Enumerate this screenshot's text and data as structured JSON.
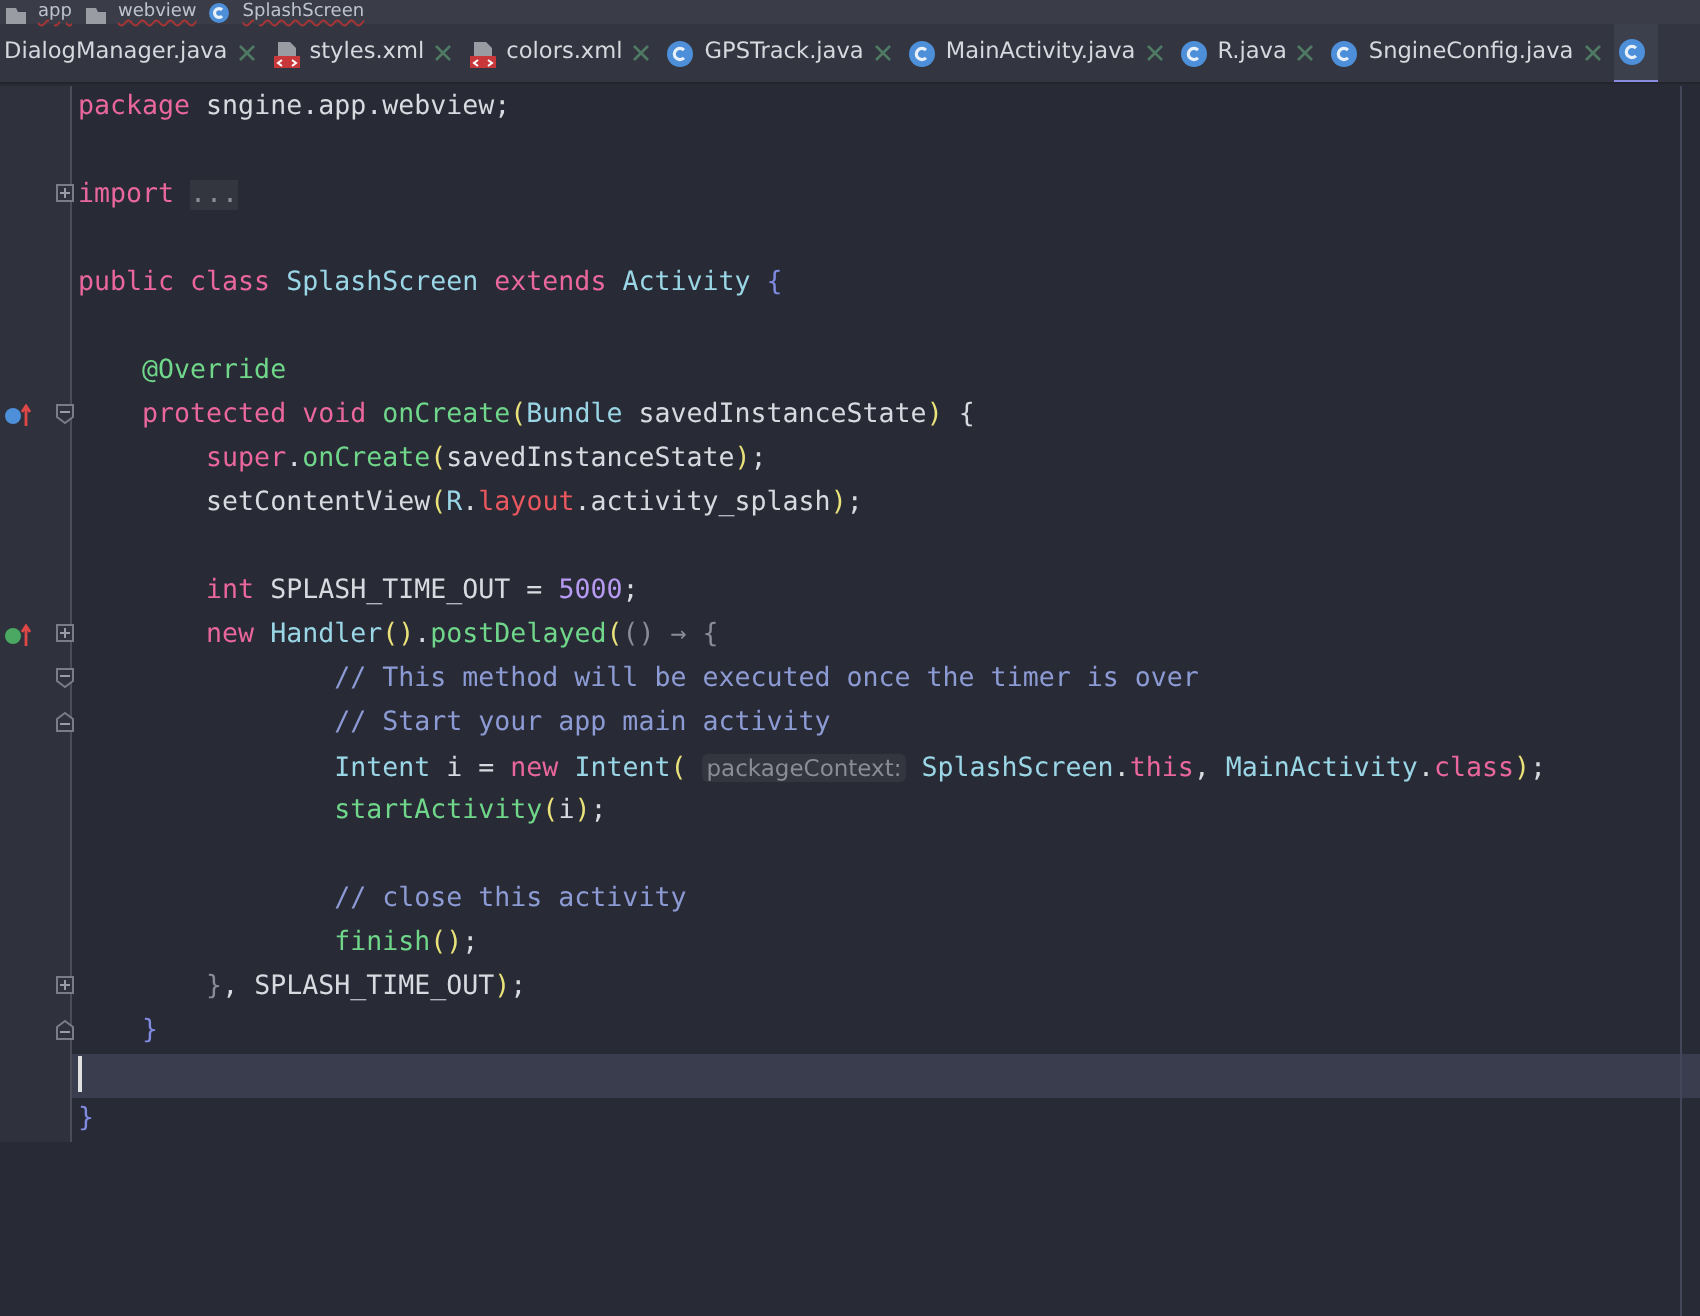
{
  "breadcrumb": [
    {
      "label": "app",
      "kind": "folder"
    },
    {
      "label": "webview",
      "kind": "folder"
    },
    {
      "label": "SplashScreen",
      "kind": "class"
    }
  ],
  "tabs": [
    {
      "label": "DialogManager.java",
      "kind": "plain",
      "selected": false
    },
    {
      "label": "styles.xml",
      "kind": "xml",
      "selected": false
    },
    {
      "label": "colors.xml",
      "kind": "xml",
      "selected": false
    },
    {
      "label": "GPSTrack.java",
      "kind": "class",
      "selected": false
    },
    {
      "label": "MainActivity.java",
      "kind": "class",
      "selected": false
    },
    {
      "label": "R.java",
      "kind": "class",
      "selected": false
    },
    {
      "label": "SngineConfig.java",
      "kind": "class",
      "selected": false
    },
    {
      "kind": "class",
      "selected": true
    }
  ],
  "lines": [
    {
      "current": false,
      "tokens": [
        {
          "text": "package ",
          "kind": "keyword"
        },
        {
          "text": "sngine.app.webview;",
          "kind": "plain"
        }
      ]
    },
    {
      "current": false
    },
    {
      "current": false,
      "gutter": [
        {
          "kind": "fold-collapsed"
        }
      ],
      "tokens": [
        {
          "text": "import ",
          "kind": "keyword"
        },
        {
          "text": "...",
          "kind": "folded"
        }
      ]
    },
    {
      "current": false
    },
    {
      "current": false,
      "tokens": [
        {
          "text": "public class ",
          "kind": "keyword"
        },
        {
          "text": "SplashScreen ",
          "kind": "type"
        },
        {
          "text": "extends ",
          "kind": "keyword"
        },
        {
          "text": "Activity ",
          "kind": "type"
        },
        {
          "text": "{",
          "kind": "brace"
        }
      ]
    },
    {
      "current": false
    },
    {
      "current": false,
      "tokens": [
        {
          "text": "    @Override",
          "kind": "annotation"
        }
      ]
    },
    {
      "current": false,
      "gutter": [
        {
          "kind": "override"
        },
        {
          "kind": "fold-start"
        }
      ],
      "tokens": [
        {
          "text": "    protected void ",
          "kind": "keyword"
        },
        {
          "text": "onCreate",
          "kind": "method"
        },
        {
          "text": "(",
          "kind": "paren"
        },
        {
          "text": "Bundle ",
          "kind": "type"
        },
        {
          "text": "savedInstanceState",
          "kind": "plain"
        },
        {
          "text": ")",
          "kind": "paren"
        },
        {
          "text": " {",
          "kind": "plain"
        }
      ]
    },
    {
      "current": false,
      "tokens": [
        {
          "text": "        super",
          "kind": "keyword"
        },
        {
          "text": ".",
          "kind": "plain"
        },
        {
          "text": "onCreate",
          "kind": "method"
        },
        {
          "text": "(",
          "kind": "paren"
        },
        {
          "text": "savedInstanceState",
          "kind": "plain"
        },
        {
          "text": ")",
          "kind": "paren"
        },
        {
          "text": ";",
          "kind": "plain"
        }
      ]
    },
    {
      "current": false,
      "tokens": [
        {
          "text": "        setContentView",
          "kind": "plain"
        },
        {
          "text": "(",
          "kind": "paren"
        },
        {
          "text": "R",
          "kind": "type"
        },
        {
          "text": ".",
          "kind": "plain"
        },
        {
          "text": "layout",
          "kind": "field"
        },
        {
          "text": ".activity_splash",
          "kind": "plain"
        },
        {
          "text": ")",
          "kind": "paren"
        },
        {
          "text": ";",
          "kind": "plain"
        }
      ]
    },
    {
      "current": false
    },
    {
      "current": false,
      "tokens": [
        {
          "text": "        int ",
          "kind": "keyword"
        },
        {
          "text": "SPLASH_TIME_OUT = ",
          "kind": "plain"
        },
        {
          "text": "5000",
          "kind": "number"
        },
        {
          "text": ";",
          "kind": "plain"
        }
      ]
    },
    {
      "current": false,
      "gutter": [
        {
          "kind": "implements"
        },
        {
          "kind": "fold-collapsed"
        }
      ],
      "tokens": [
        {
          "text": "        new ",
          "kind": "keyword"
        },
        {
          "text": "Handler",
          "kind": "type"
        },
        {
          "text": "()",
          "kind": "paren"
        },
        {
          "text": ".",
          "kind": "plain"
        },
        {
          "text": "postDelayed",
          "kind": "method"
        },
        {
          "text": "(",
          "kind": "paren"
        },
        {
          "text": "() → {",
          "kind": "lambda"
        }
      ]
    },
    {
      "current": false,
      "gutter": [
        {
          "kind": "fold-start"
        }
      ],
      "tokens": [
        {
          "text": "                // This method will be executed once the timer is over",
          "kind": "comment"
        }
      ]
    },
    {
      "current": false,
      "gutter": [
        {
          "kind": "fold-end"
        }
      ],
      "tokens": [
        {
          "text": "                // Start your app main activity",
          "kind": "comment"
        }
      ]
    },
    {
      "current": false,
      "tokens": [
        {
          "text": "                Intent ",
          "kind": "type"
        },
        {
          "text": "i = ",
          "kind": "plain"
        },
        {
          "text": "new ",
          "kind": "keyword"
        },
        {
          "text": "Intent",
          "kind": "type"
        },
        {
          "text": "( ",
          "kind": "paren"
        },
        {
          "text": "packageContext:",
          "kind": "hint"
        },
        {
          "text": " SplashScreen",
          "kind": "type"
        },
        {
          "text": ".",
          "kind": "plain"
        },
        {
          "text": "this",
          "kind": "keyword"
        },
        {
          "text": ", ",
          "kind": "plain"
        },
        {
          "text": "MainActivity",
          "kind": "type"
        },
        {
          "text": ".",
          "kind": "plain"
        },
        {
          "text": "class",
          "kind": "keyword"
        },
        {
          "text": ")",
          "kind": "paren"
        },
        {
          "text": ";",
          "kind": "plain"
        }
      ]
    },
    {
      "current": false,
      "tokens": [
        {
          "text": "                startActivity",
          "kind": "method"
        },
        {
          "text": "(",
          "kind": "paren"
        },
        {
          "text": "i",
          "kind": "plain"
        },
        {
          "text": ")",
          "kind": "paren"
        },
        {
          "text": ";",
          "kind": "plain"
        }
      ]
    },
    {
      "current": false
    },
    {
      "current": false,
      "tokens": [
        {
          "text": "                // close this activity",
          "kind": "comment"
        }
      ]
    },
    {
      "current": false,
      "tokens": [
        {
          "text": "                finish",
          "kind": "method"
        },
        {
          "text": "()",
          "kind": "paren"
        },
        {
          "text": ";",
          "kind": "plain"
        }
      ]
    },
    {
      "current": false,
      "gutter": [
        {
          "kind": "fold-collapsed"
        }
      ],
      "tokens": [
        {
          "text": "        }",
          "kind": "lambda"
        },
        {
          "text": ", SPLASH_TIME_OUT",
          "kind": "plain"
        },
        {
          "text": ")",
          "kind": "paren"
        },
        {
          "text": ";",
          "kind": "plain"
        }
      ]
    },
    {
      "current": false,
      "gutter": [
        {
          "kind": "fold-end"
        }
      ],
      "tokens": [
        {
          "text": "    }",
          "kind": "brace"
        }
      ]
    },
    {
      "current": true
    },
    {
      "current": false,
      "tokens": [
        {
          "text": "}",
          "kind": "brace"
        }
      ]
    }
  ]
}
